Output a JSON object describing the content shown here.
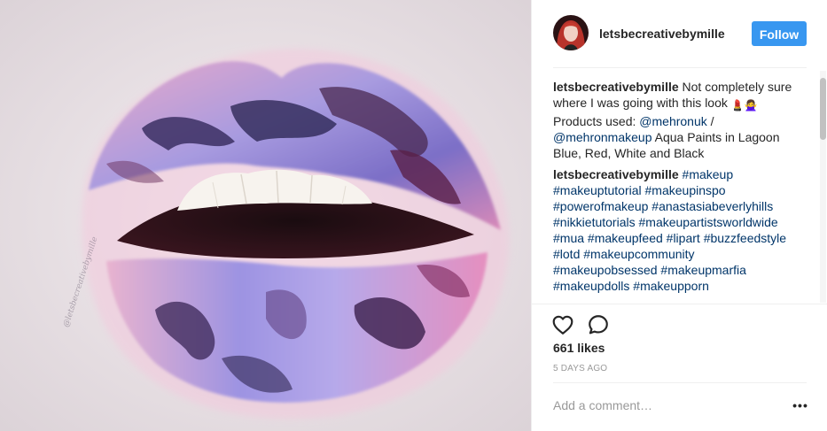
{
  "photo": {
    "alt": "Lips painted with purple, pink and navy watercolor makeup",
    "watermark": "@letsbecreativebymille"
  },
  "header": {
    "username": "letsbecreativebymille",
    "follow_label": "Follow",
    "accent_color": "#3897f0"
  },
  "comments": [
    {
      "username": "letsbecreativebymille",
      "parts": [
        {
          "type": "text",
          "text": " Not completely sure where I was going with this look "
        },
        {
          "type": "emoji",
          "text": "💄🙅‍♀️"
        },
        {
          "type": "text",
          "text": " Products used: "
        },
        {
          "type": "link",
          "text": "@mehronuk"
        },
        {
          "type": "text",
          "text": " / "
        },
        {
          "type": "link",
          "text": "@mehronmakeup"
        },
        {
          "type": "text",
          "text": " Aqua Paints in Lagoon Blue, Red, White and Black"
        }
      ]
    },
    {
      "username": "letsbecreativebymille",
      "parts": [
        {
          "type": "text",
          "text": " "
        },
        {
          "type": "link",
          "text": "#makeup"
        },
        {
          "type": "text",
          "text": " "
        },
        {
          "type": "link",
          "text": "#makeuptutorial"
        },
        {
          "type": "text",
          "text": " "
        },
        {
          "type": "link",
          "text": "#makeupinspo"
        },
        {
          "type": "text",
          "text": " "
        },
        {
          "type": "link",
          "text": "#powerofmakeup"
        },
        {
          "type": "text",
          "text": " "
        },
        {
          "type": "link",
          "text": "#anastasiabeverlyhills"
        },
        {
          "type": "text",
          "text": " "
        },
        {
          "type": "link",
          "text": "#nikkietutorials"
        },
        {
          "type": "text",
          "text": " "
        },
        {
          "type": "link",
          "text": "#makeupartistsworldwide"
        },
        {
          "type": "text",
          "text": " "
        },
        {
          "type": "link",
          "text": "#mua"
        },
        {
          "type": "text",
          "text": " "
        },
        {
          "type": "link",
          "text": "#makeupfeed"
        },
        {
          "type": "text",
          "text": " "
        },
        {
          "type": "link",
          "text": "#lipart"
        },
        {
          "type": "text",
          "text": " "
        },
        {
          "type": "link",
          "text": "#buzzfeedstyle"
        },
        {
          "type": "text",
          "text": " "
        },
        {
          "type": "link",
          "text": "#lotd"
        },
        {
          "type": "text",
          "text": " "
        },
        {
          "type": "link",
          "text": "#makeupcommunity"
        },
        {
          "type": "text",
          "text": " "
        },
        {
          "type": "link",
          "text": "#makeupobsessed"
        },
        {
          "type": "text",
          "text": " "
        },
        {
          "type": "link",
          "text": "#makeupmarfia"
        },
        {
          "type": "text",
          "text": " "
        },
        {
          "type": "link",
          "text": "#makeupdolls"
        },
        {
          "type": "text",
          "text": " "
        },
        {
          "type": "link",
          "text": "#makeupporn"
        }
      ]
    }
  ],
  "actions": {
    "like_icon": "heart-icon",
    "comment_icon": "speech-bubble-icon"
  },
  "likes_text": "661 likes",
  "timestamp": "5 DAYS AGO",
  "comment_box": {
    "placeholder": "Add a comment…",
    "more_label": "•••"
  },
  "colors": {
    "link": "#003569",
    "text": "#262626",
    "muted": "#999999",
    "border": "#efefef"
  }
}
